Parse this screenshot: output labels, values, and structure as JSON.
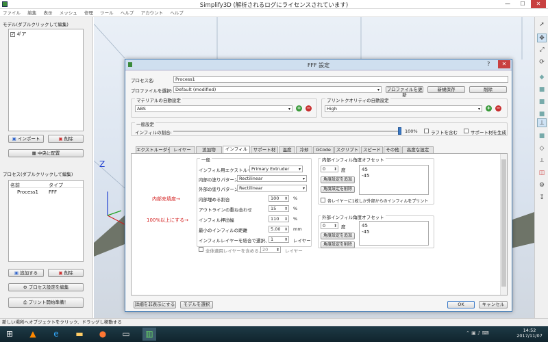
{
  "app": {
    "title": "Simplify3D (解析されるログにライセンスされています)",
    "window_controls": {
      "minimize": "—",
      "maximize": "☐",
      "close": "✕"
    }
  },
  "menu": [
    "ファイル",
    "編集",
    "表示",
    "メッシュ",
    "修理",
    "ツール",
    "ヘルプ",
    "アカウント",
    "ヘルプ"
  ],
  "left": {
    "models_label": "モデル(ダブルクリックして編集)",
    "models": [
      {
        "name": "ギア",
        "checked": true
      }
    ],
    "import_label": "インポート",
    "remove_label": "削除",
    "center_label": "中央に配置",
    "processes_label": "プロセス(ダブルクリックして編集)",
    "proc_headers": {
      "name": "名前",
      "type": "タイプ"
    },
    "processes": [
      {
        "name": "Process1",
        "type": "FFF"
      }
    ],
    "add_label": "追加する",
    "remove2_label": "削除",
    "edit_process_label": "プロセス設定を編集",
    "prepare_label": "プリント開始準備！"
  },
  "status": "新しい場所へオブジェクトをクリック、ドラッグし移動する",
  "viewport": {
    "axis_z": "Z"
  },
  "clock": {
    "time": "14:52",
    "date": "2017/11/07"
  },
  "dialog": {
    "title": "FFF 設定",
    "help": "?",
    "close": "✕",
    "process_name_label": "プロセス名:",
    "process_name": "Process1",
    "profile_label": "プロファイルを選択:",
    "profile_value": "Default (modified)",
    "update_profile": "プロファイルを更新",
    "save_new": "新規保存",
    "delete": "削除",
    "material_label": "マテリアルの自動設定",
    "material_value": "ABS",
    "quality_label": "プリントクオリティの自動設定",
    "quality_value": "High",
    "general_label": "一般設定",
    "infill_amount_label": "インフィルの割合:",
    "infill_amount": "100%",
    "include_raft": "ラフトを含む",
    "generate_support": "サポート材を生成",
    "tabs": [
      "エクストルーダー",
      "レイヤー",
      "追加物",
      "インフィル",
      "サポート材",
      "温度",
      "冷却",
      "GCode",
      "スクリプト",
      "スピード",
      "その他",
      "高度な設定"
    ],
    "active_tab": 3,
    "general_group": "一般",
    "infill_extruder_label": "インフィル用エクストルーダー",
    "infill_extruder_value": "Primary Extruder",
    "internal_pattern_label": "内部の塗りパターン",
    "internal_pattern_value": "Rectilinear",
    "external_pattern_label": "外部の塗りパターン",
    "external_pattern_value": "Rectilinear",
    "infill_percent_label": "内部埋める割合",
    "infill_percent": "100",
    "outline_overlap_label": "アウトラインの重ね合わせ",
    "outline_overlap": "15",
    "extrusion_width_label": "インフィル押出幅",
    "extrusion_width": "110",
    "min_length_label": "最小のインフィルの距離",
    "min_length": "5.00",
    "mm": "mm",
    "percent": "%",
    "combine_label": "インフィルレイヤーを結合で選択、毎",
    "combine_value": "1",
    "layer_unit": "レイヤー",
    "dense_label": "全体適用レイヤーを含める、毎",
    "dense_value": "20",
    "layer_unit2": "レイヤー",
    "internal_angle_label": "内部インフィル角度オフセット",
    "angle_value": "0",
    "degree": "度",
    "add_angle": "角度設定を追加",
    "remove_angle": "角度設定を削除",
    "internal_angles": [
      "45",
      "-45"
    ],
    "print_every_layer": "各レイヤーに1枚しか外部からのインフィルをプリント",
    "external_angle_label": "外部インフィル角度オフセット",
    "angle_value2": "0",
    "degree2": "度",
    "add_angle2": "角度設定を追加",
    "remove_angle2": "角度設定を削除",
    "external_angles": [
      "45",
      "-45"
    ],
    "note_density": "内部充填度→",
    "note_over": "100%以上にする→",
    "hide_advanced": "詳細を非表示にする",
    "select_models": "モデルを選択",
    "ok": "OK",
    "cancel": "キャンセル"
  }
}
